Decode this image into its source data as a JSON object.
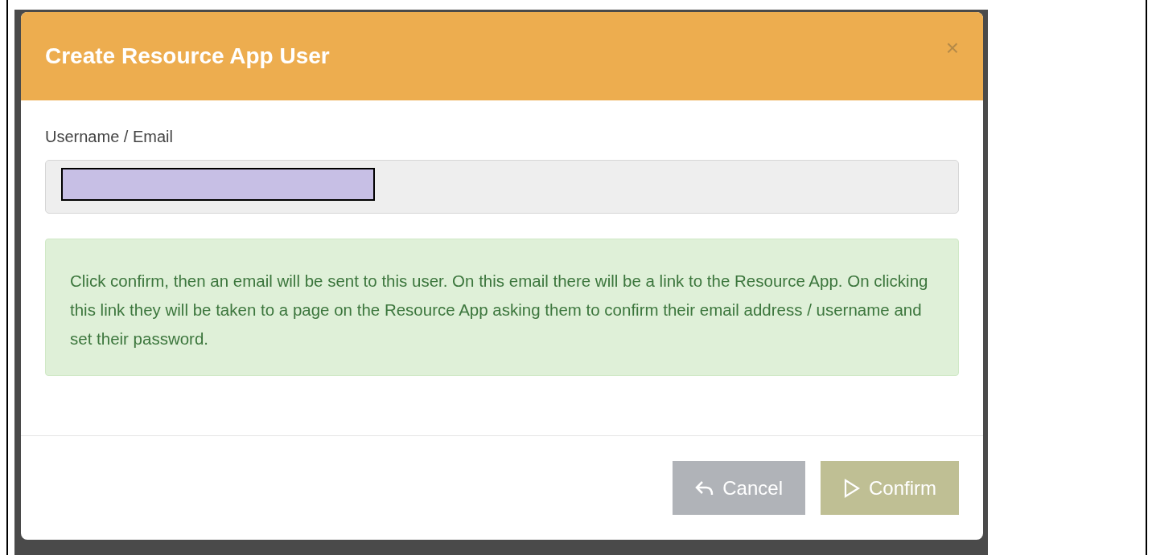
{
  "dialog": {
    "title": "Create Resource App User",
    "close": "×",
    "field": {
      "label": "Username / Email",
      "redacted": true
    },
    "alert": "Click confirm, then an email will be sent to this user. On this email there will be a link to the Resource App. On clicking this link they will be taken to a page on the Resource App asking them to confirm their email address / username and set their password.",
    "buttons": [
      {
        "kind": "cancel",
        "label": "Cancel"
      },
      {
        "kind": "confirm",
        "label": "Confirm"
      }
    ]
  }
}
